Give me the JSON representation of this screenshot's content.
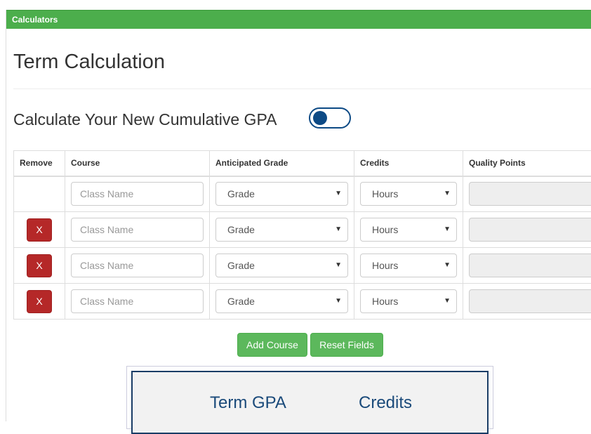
{
  "panel": {
    "header": "Calculators"
  },
  "page": {
    "title": "Term Calculation"
  },
  "toggle": {
    "label": "Calculate Your New Cumulative GPA",
    "on": false,
    "color": "#0d4a85"
  },
  "table": {
    "headers": {
      "remove": "Remove",
      "course": "Course",
      "grade": "Anticipated Grade",
      "credits": "Credits",
      "quality": "Quality Points"
    },
    "rows": [
      {
        "removable": false,
        "course_placeholder": "Class Name",
        "grade": "Grade",
        "credits": "Hours",
        "quality_points": ""
      },
      {
        "removable": true,
        "remove_label": "X",
        "course_placeholder": "Class Name",
        "grade": "Grade",
        "credits": "Hours",
        "quality_points": ""
      },
      {
        "removable": true,
        "remove_label": "X",
        "course_placeholder": "Class Name",
        "grade": "Grade",
        "credits": "Hours",
        "quality_points": ""
      },
      {
        "removable": true,
        "remove_label": "X",
        "course_placeholder": "Class Name",
        "grade": "Grade",
        "credits": "Hours",
        "quality_points": ""
      }
    ]
  },
  "actions": {
    "add": "Add Course",
    "reset": "Reset Fields"
  },
  "results": {
    "gpa_label": "Term GPA",
    "credits_label": "Credits"
  },
  "colors": {
    "header_green": "#4cae4c",
    "remove_red": "#b52828",
    "button_green": "#5cb85c",
    "navy": "#1a3d66"
  }
}
